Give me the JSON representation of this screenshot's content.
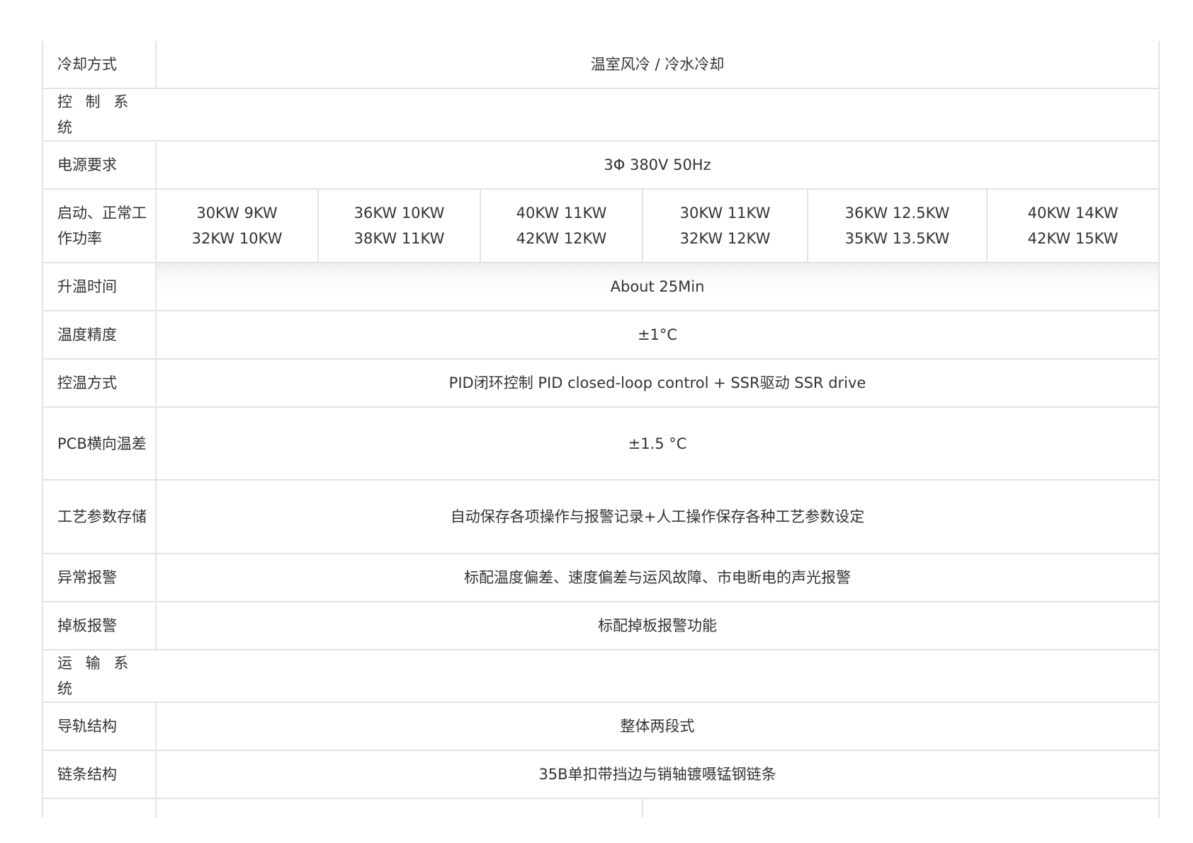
{
  "cooling": {
    "label": "冷却方式",
    "value": "温室风冷 / 冷水冷却"
  },
  "control_section": {
    "label": "控 制 系 统"
  },
  "power": {
    "label": "电源要求",
    "value": "3Φ 380V 50Hz"
  },
  "power_rating": {
    "label": "启动、正常工作功率",
    "cells": [
      {
        "line1": "30KW 9KW",
        "line2": "32KW 10KW"
      },
      {
        "line1": "36KW 10KW",
        "line2": "38KW 11KW"
      },
      {
        "line1": "40KW 11KW",
        "line2": "42KW 12KW"
      },
      {
        "line1": "30KW 11KW",
        "line2": "32KW 12KW"
      },
      {
        "line1": "36KW 12.5KW",
        "line2": "35KW 13.5KW"
      },
      {
        "line1": "40KW 14KW",
        "line2": "42KW 15KW"
      }
    ]
  },
  "heatup_time": {
    "label": "升温时间",
    "value": "About 25Min"
  },
  "temp_accuracy": {
    "label": "温度精度",
    "value": "±1°C"
  },
  "temp_control": {
    "label": "控温方式",
    "value": "PID闭环控制 PID closed-loop control + SSR驱动 SSR drive"
  },
  "pcb_temp_diff": {
    "label": "PCB横向温差",
    "value": "±1.5 °C"
  },
  "param_storage": {
    "label": "工艺参数存储",
    "value": "自动保存各项操作与报警记录+人工操作保存各种工艺参数设定"
  },
  "abnormal_alarm": {
    "label": "异常报警",
    "value": "标配温度偏差、速度偏差与运风故障、市电断电的声光报警"
  },
  "board_drop_alarm": {
    "label": "掉板报警",
    "value": "标配掉板报警功能"
  },
  "transport_section": {
    "label": "运 输 系 统"
  },
  "rail_structure": {
    "label": "导轨结构",
    "value": "整体两段式"
  },
  "chain_structure": {
    "label": "链条结构",
    "value": "35B单扣带挡边与销轴镀嗫锰钢链条"
  },
  "colors": {
    "border": "#e3e3e3",
    "text": "#333333",
    "background": "#ffffff"
  }
}
